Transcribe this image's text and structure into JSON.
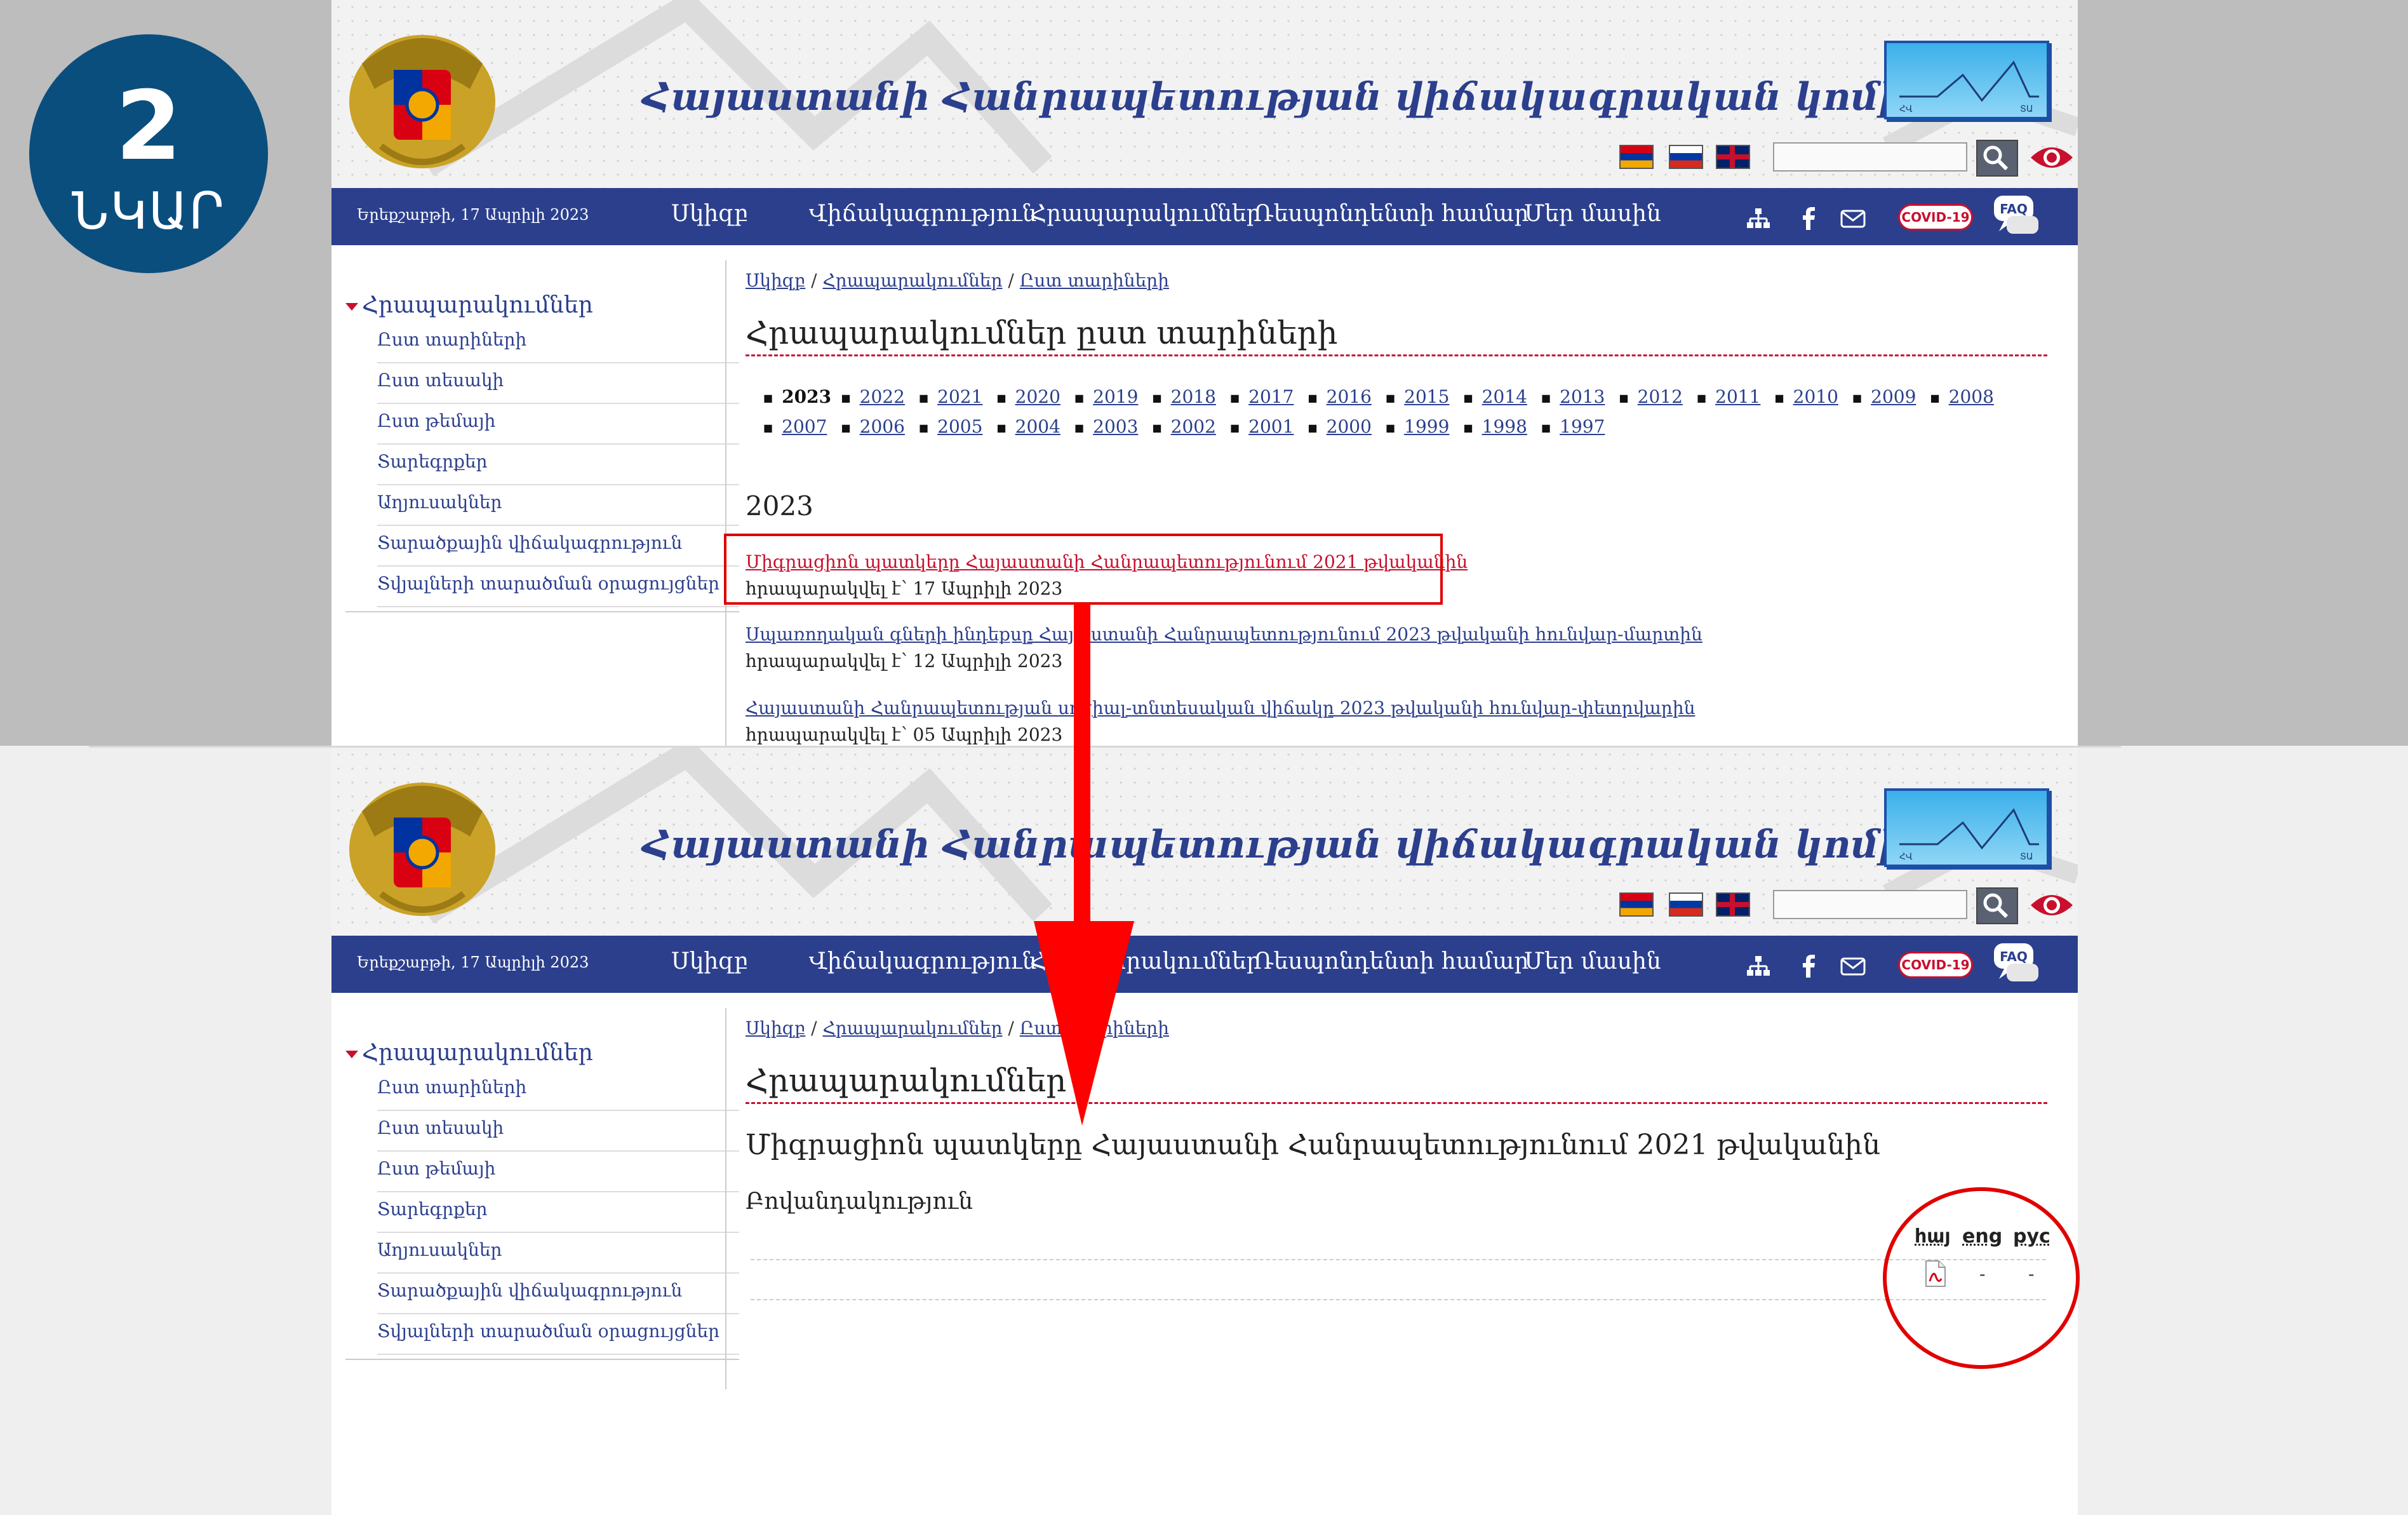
{
  "badge": {
    "number": "2",
    "label": "ՆԿԱՐ"
  },
  "site": {
    "title": "Հայաստանի Հանրապետության վիճակագրական կոմիտե",
    "date": "Երեքշաբթի, 17 Ապրիլի 2023",
    "search_placeholder": "",
    "covid_label": "COVID-19",
    "faq_label": "FAQ",
    "logo_left": "ՀՎ",
    "logo_right": "ՏԱ"
  },
  "nav": [
    "Սկիզբ",
    "Վիճակագրություն",
    "Հրապարակումներ",
    "Ռեսպոնդենտի համար",
    "Մեր մասին"
  ],
  "sidebar": {
    "heading": "Հրապարակումներ",
    "items": [
      "Ըստ տարիների",
      "Ըստ տեսակի",
      "Ըստ թեմայի",
      "Տարեգրքեր",
      "Աղյուսակներ",
      "Տարածքային վիճակագրություն",
      "Տվյալների տարածման օրացույցներ"
    ]
  },
  "screen1": {
    "breadcrumb": [
      "Սկիզբ",
      "Հրապարակումներ",
      "Ըստ տարիների"
    ],
    "heading": "Հրապարակումներ ըստ տարիների",
    "years_row1": [
      "2023",
      "2022",
      "2021",
      "2020",
      "2019",
      "2018",
      "2017",
      "2016",
      "2015",
      "2014",
      "2013",
      "2012",
      "2011",
      "2010",
      "2009",
      "2008"
    ],
    "years_row2": [
      "2007",
      "2006",
      "2005",
      "2004",
      "2003",
      "2002",
      "2001",
      "2000",
      "1999",
      "1998",
      "1997"
    ],
    "section_year": "2023",
    "publications": [
      {
        "title": "Միգրացիոն պատկերը Հայաստանի Հանրապետությունում 2021 թվականին",
        "date": "հրապարակվել է՝ 17 Ապրիլի 2023"
      },
      {
        "title": "Սպառողական գների ինդեքսը Հայաստանի Հանրապետությունում 2023 թվականի հունվար-մարտին",
        "date": "հրապարակվել է՝ 12 Ապրիլի 2023"
      },
      {
        "title": "Հայաստանի Հանրապետության սոցիալ-տնտեսական վիճակը 2023 թվականի հունվար-փետրվարին",
        "date": "հրապարակվել է՝ 05 Ապրիլի 2023"
      }
    ]
  },
  "screen2": {
    "breadcrumb": [
      "Սկիզբ",
      "Հրապարակումներ",
      "Ըստ տարիների"
    ],
    "heading": "Հրապարակումներ",
    "pub_title": "Միգրացիոն պատկերը Հայաստանի Հանրապետությունում 2021 թվականին",
    "contents_label": "Բովանդակություն",
    "lang_headers": [
      "հայ",
      "eng",
      "рус"
    ],
    "lang_values": [
      "-",
      "-"
    ]
  },
  "colors": {
    "brand": "#2b3f8d",
    "accent_red": "#e00000",
    "badge": "#0a4e7e"
  }
}
